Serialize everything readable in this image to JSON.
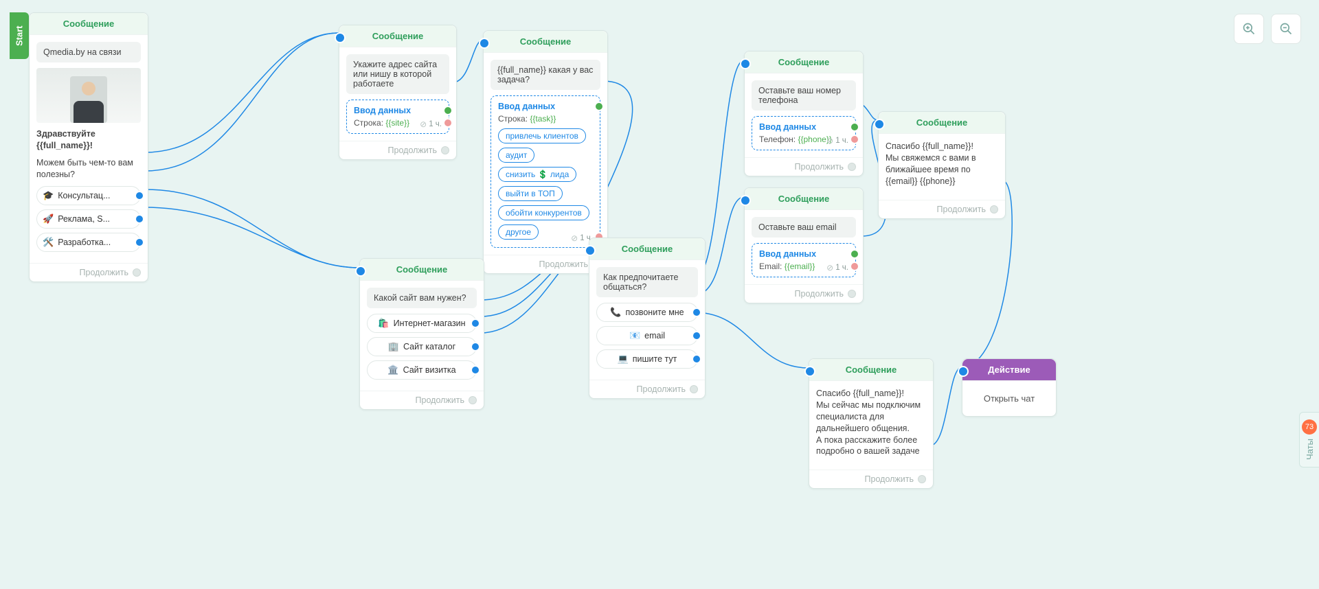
{
  "start_label": "Start",
  "continue_label": "Продолжить",
  "hdr_message": "Сообщение",
  "hdr_action": "Действие",
  "input_title": "Ввод данных",
  "timer": "1 ч.",
  "zoom": {
    "in": "+",
    "out": "-"
  },
  "chats": {
    "count": "73",
    "label": "Чаты"
  },
  "node1": {
    "bubble": "Qmedia.by на связи",
    "greet": "Здравствуйте {{full_name}}!",
    "sub": "Можем быть чем-то вам полезны?",
    "opts": [
      {
        "ico": "🎓",
        "label": "Консультац..."
      },
      {
        "ico": "🚀",
        "label": "Реклама, S..."
      },
      {
        "ico": "🛠️",
        "label": "Разработка..."
      }
    ]
  },
  "node2": {
    "bubble": "Укажите адрес сайта или нишу в которой работаете",
    "input_line_prefix": "Строка:",
    "input_token": "{{site}}"
  },
  "node3": {
    "bubble": "{{full_name}} какая у вас задача?",
    "input_line_prefix": "Строка:",
    "input_token": "{{task}}",
    "pills": [
      "привлечь клиентов",
      "аудит",
      "снизить 💲 лида",
      "выйти в ТОП",
      "обойти конкурентов",
      "другое"
    ]
  },
  "node4": {
    "bubble": "Какой сайт вам нужен?",
    "opts": [
      {
        "ico": "🛍️",
        "label": "Интернет-магазин"
      },
      {
        "ico": "🏢",
        "label": "Сайт каталог"
      },
      {
        "ico": "🏛️",
        "label": "Сайт визитка"
      }
    ]
  },
  "node5": {
    "bubble": "Как предпочитаете общаться?",
    "opts": [
      {
        "ico": "📞",
        "label": "позвоните мне"
      },
      {
        "ico": "📧",
        "label": "email"
      },
      {
        "ico": "💻",
        "label": "пишите тут"
      }
    ]
  },
  "node6": {
    "bubble": "Оставьте ваш номер телефона",
    "input_line_prefix": "Телефон:",
    "input_token": "{{phone}}"
  },
  "node7": {
    "bubble": "Оставьте ваш email",
    "input_line_prefix": "Email:",
    "input_token": "{{email}}"
  },
  "node8": {
    "text": "Спасибо {{full_name}}!\nМы свяжемся с вами в ближайшее время по {{email}} {{phone}}"
  },
  "node9": {
    "text": "Спасибо {{full_name}}!\nМы сейчас мы подключим специалиста для дальнейшего общения.\nА пока расскажите более подробно о вашей задаче"
  },
  "node10": {
    "text": "Открыть чат"
  }
}
